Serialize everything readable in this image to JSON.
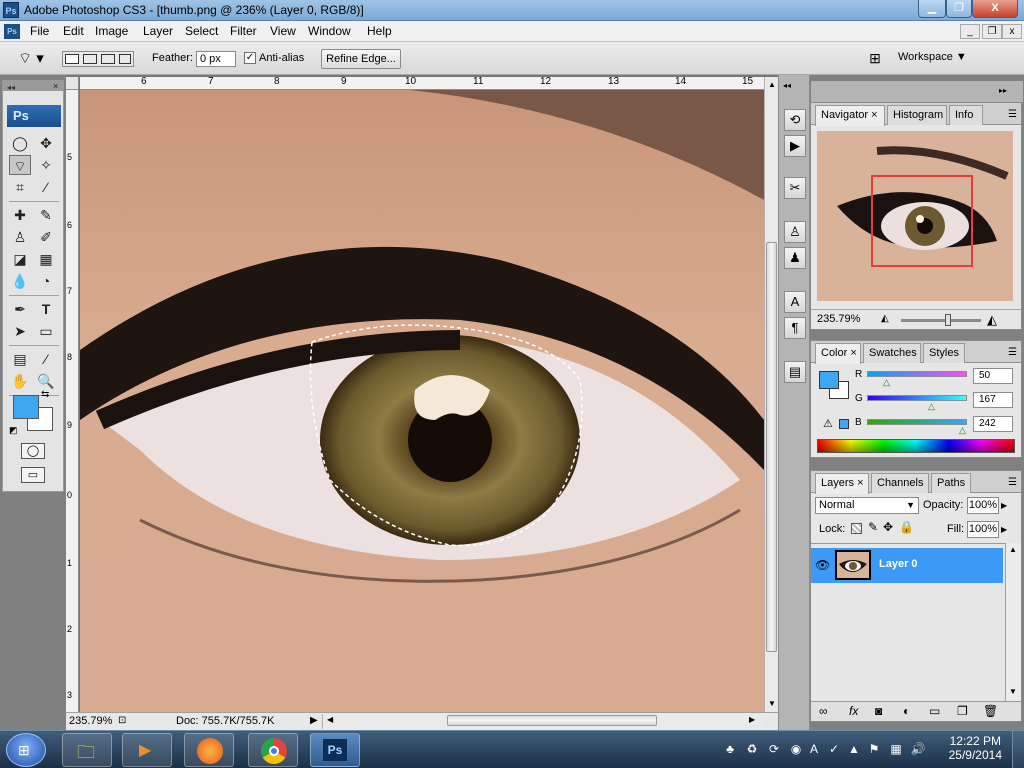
{
  "window": {
    "app_icon": "ps-icon",
    "title": "Adobe Photoshop CS3 - [thumb.png @ 236% (Layer 0, RGB/8)]",
    "minimize_glyph": "▁",
    "maximize_glyph": "❐",
    "close_glyph": "X"
  },
  "menu": {
    "items": [
      "File",
      "Edit",
      "Image",
      "Layer",
      "Select",
      "Filter",
      "View",
      "Window",
      "Help"
    ],
    "mdi_glyphs": [
      "_",
      "❐",
      "x"
    ]
  },
  "options_bar": {
    "feather_label": "Feather:",
    "feather_value": "0 px",
    "antialias_label": "Anti-alias",
    "antialias_checked": true,
    "refine_edge_label": "Refine Edge...",
    "workspace_label": "Workspace"
  },
  "tools": {
    "ps_label": "Ps",
    "foreground_color": "#3ea7f2",
    "background_color": "#ffffff"
  },
  "rulers": {
    "top": [
      "6",
      "7",
      "8",
      "9",
      "10",
      "11",
      "12",
      "13",
      "14",
      "15"
    ],
    "left": [
      "5",
      "6",
      "7",
      "8",
      "9",
      "0",
      "1",
      "2",
      "3"
    ]
  },
  "status_bar": {
    "zoom": "235.79%",
    "doc": "Doc: 755.7K/755.7K"
  },
  "navigator": {
    "tabs": [
      "Navigator",
      "Histogram",
      "Info"
    ],
    "zoom": "235.79%",
    "view_box_color": "#ea3b3b"
  },
  "color_panel": {
    "tabs": [
      "Color",
      "Swatches",
      "Styles"
    ],
    "channels": [
      {
        "label": "R",
        "value": "50"
      },
      {
        "label": "G",
        "value": "167"
      },
      {
        "label": "B",
        "value": "242"
      }
    ],
    "swatch_color": "#3ea7f2"
  },
  "layers_panel": {
    "tabs": [
      "Layers",
      "Channels",
      "Paths"
    ],
    "blend_mode": "Normal",
    "opacity_label": "Opacity:",
    "opacity_value": "100%",
    "lock_label": "Lock:",
    "fill_label": "Fill:",
    "fill_value": "100%",
    "layer_name": "Layer 0",
    "footer_icons": [
      "link-icon",
      "fx-icon",
      "mask-icon",
      "adjustment-icon",
      "group-icon",
      "new-layer-icon",
      "trash-icon"
    ]
  },
  "taskbar": {
    "time": "12:22 PM",
    "date": "25/9/2014",
    "apps": [
      "start-orb-icon",
      "file-explorer-icon",
      "media-player-icon",
      "firefox-icon",
      "chrome-icon",
      "photoshop-icon"
    ]
  }
}
